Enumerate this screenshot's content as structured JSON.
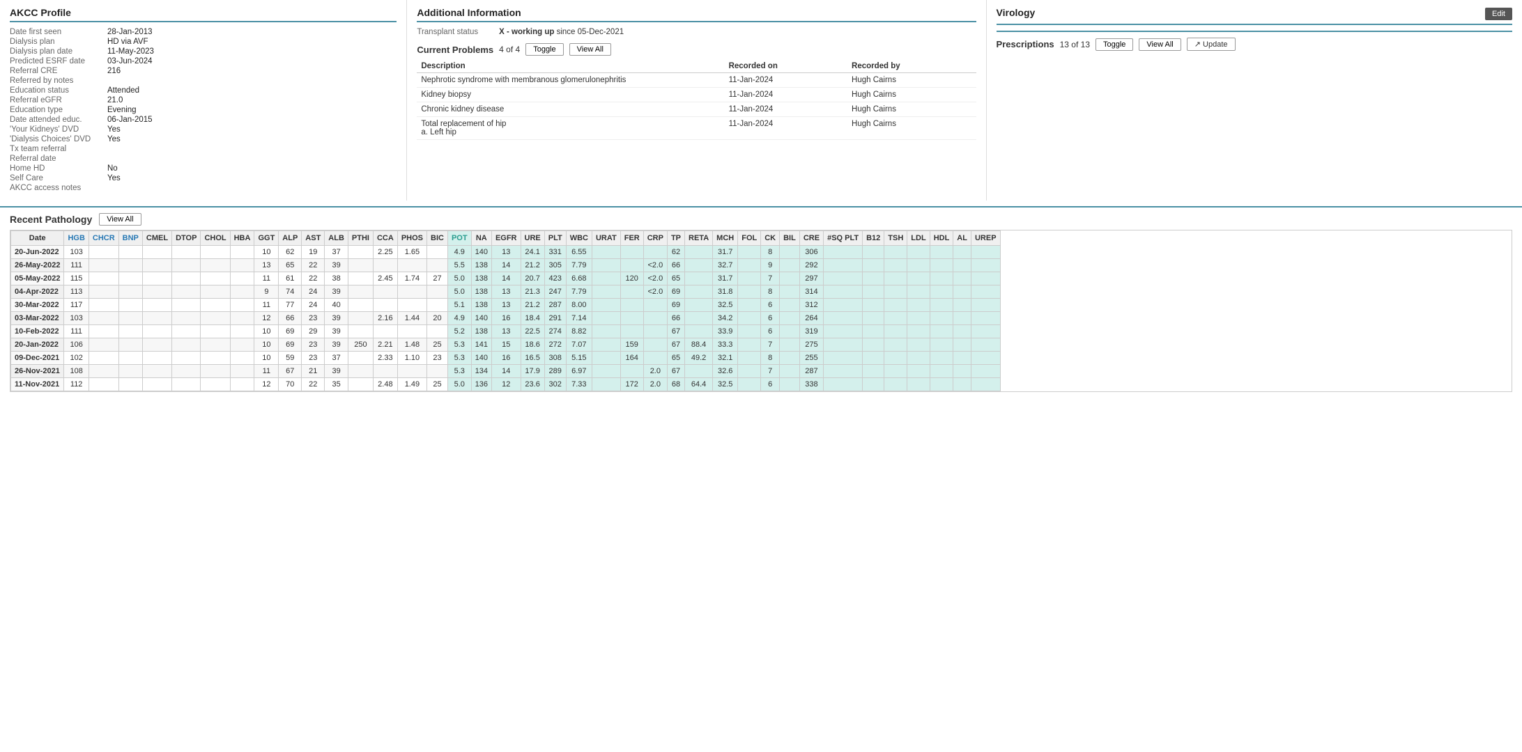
{
  "akcc": {
    "title": "AKCC Profile",
    "fields": [
      {
        "label": "Date first seen",
        "value": "28-Jan-2013"
      },
      {
        "label": "Dialysis plan",
        "value": "HD via AVF"
      },
      {
        "label": "Dialysis plan date",
        "value": "11-May-2023"
      },
      {
        "label": "Predicted ESRF date",
        "value": "03-Jun-2024"
      },
      {
        "label": "Referral CRE",
        "value": "216"
      },
      {
        "label": "Referred by notes",
        "value": ""
      },
      {
        "label": "Education status",
        "value": "Attended"
      },
      {
        "label": "Referral eGFR",
        "value": "21.0"
      },
      {
        "label": "Education type",
        "value": "Evening"
      },
      {
        "label": "Date attended educ.",
        "value": "06-Jan-2015"
      },
      {
        "label": "'Your Kidneys' DVD",
        "value": "Yes"
      },
      {
        "label": "'Dialysis Choices' DVD",
        "value": "Yes"
      },
      {
        "label": "Tx team referral",
        "value": ""
      },
      {
        "label": "Referral date",
        "value": ""
      },
      {
        "label": "Home HD",
        "value": "No"
      },
      {
        "label": "Self Care",
        "value": "Yes"
      },
      {
        "label": "AKCC access notes",
        "value": ""
      }
    ]
  },
  "additional": {
    "title": "Additional Information",
    "transplant_label": "Transplant status",
    "transplant_value": "X - working up since 05-Dec-2021",
    "transplant_bold": "X - working up",
    "transplant_rest": " since 05-Dec-2021",
    "current_problems": {
      "title": "Current Problems",
      "count": "4 of 4",
      "toggle_label": "Toggle",
      "view_all_label": "View All",
      "columns": [
        "Description",
        "Recorded on",
        "Recorded by"
      ],
      "rows": [
        {
          "desc": "Nephrotic syndrome with membranous glomerulonephritis",
          "date": "11-Jan-2024",
          "by": "Hugh Cairns"
        },
        {
          "desc": "Kidney biopsy",
          "date": "11-Jan-2024",
          "by": "Hugh Cairns"
        },
        {
          "desc": "Chronic kidney disease",
          "date": "11-Jan-2024",
          "by": "Hugh Cairns"
        },
        {
          "desc": "Total replacement of hip\na.  Left hip",
          "date": "11-Jan-2024",
          "by": "Hugh Cairns"
        }
      ]
    }
  },
  "virology": {
    "title": "Virology",
    "edit_label": "Edit",
    "prescriptions": {
      "label": "Prescriptions",
      "count": "13 of 13",
      "toggle_label": "Toggle",
      "view_all_label": "View All",
      "update_label": "↗ Update"
    }
  },
  "pathology": {
    "title": "Recent Pathology",
    "view_all_label": "View All",
    "columns": [
      "Date",
      "HGB",
      "CHCR",
      "BNP",
      "CMEL",
      "DTOP",
      "CHOL",
      "HBA",
      "GGT",
      "ALP",
      "AST",
      "ALB",
      "PTHI",
      "CCA",
      "PHOS",
      "BIC",
      "POT",
      "NA",
      "EGFR",
      "URE",
      "PLT",
      "WBC",
      "URAT",
      "FER",
      "CRP",
      "TP",
      "RETA",
      "MCH",
      "FOL",
      "CK",
      "BIL",
      "CRE",
      "#SQ PLT",
      "B12",
      "TSH",
      "LDL",
      "HDL",
      "AL",
      "UREP"
    ],
    "rows": [
      {
        "date": "20-Jun-2022",
        "HGB": "103",
        "CHCR": "",
        "BNP": "",
        "CMEL": "",
        "DTOP": "",
        "CHOL": "",
        "HBA": "",
        "GGT": "10",
        "ALP": "62",
        "AST": "19",
        "ALB": "37",
        "PTHI": "",
        "CCA": "2.25",
        "PHOS": "1.65",
        "BIC": "",
        "POT": "4.9",
        "NA": "140",
        "EGFR": "13",
        "URE": "24.1",
        "PLT": "331",
        "WBC": "6.55",
        "URAT": "",
        "FER": "",
        "CRP": "",
        "TP": "62",
        "RETA": "",
        "MCH": "31.7",
        "FOL": "",
        "CK": "8",
        "BIL": "",
        "CRE": "306",
        "SQ_PLT": "",
        "B12": "",
        "TSH": "",
        "LDL": "",
        "HDL": "",
        "AL": "",
        "UREP": ""
      },
      {
        "date": "26-May-2022",
        "HGB": "111",
        "CHCR": "",
        "BNP": "",
        "CMEL": "",
        "DTOP": "",
        "CHOL": "",
        "HBA": "",
        "GGT": "13",
        "ALP": "65",
        "AST": "22",
        "ALB": "39",
        "PTHI": "",
        "CCA": "",
        "PHOS": "",
        "BIC": "",
        "POT": "5.5",
        "NA": "138",
        "EGFR": "14",
        "URE": "21.2",
        "PLT": "305",
        "WBC": "7.79",
        "URAT": "",
        "FER": "",
        "CRP": "<2.0",
        "TP": "66",
        "RETA": "",
        "MCH": "32.7",
        "FOL": "",
        "CK": "9",
        "BIL": "",
        "CRE": "292",
        "SQ_PLT": "",
        "B12": "",
        "TSH": "",
        "LDL": "",
        "HDL": "",
        "AL": "",
        "UREP": ""
      },
      {
        "date": "05-May-2022",
        "HGB": "115",
        "CHCR": "",
        "BNP": "",
        "CMEL": "",
        "DTOP": "",
        "CHOL": "",
        "HBA": "",
        "GGT": "11",
        "ALP": "61",
        "AST": "22",
        "ALB": "38",
        "PTHI": "",
        "CCA": "2.45",
        "PHOS": "1.74",
        "BIC": "27",
        "POT": "5.0",
        "NA": "138",
        "EGFR": "14",
        "URE": "20.7",
        "PLT": "423",
        "WBC": "6.68",
        "URAT": "",
        "FER": "120",
        "CRP": "<2.0",
        "TP": "65",
        "RETA": "",
        "MCH": "31.7",
        "FOL": "",
        "CK": "7",
        "BIL": "",
        "CRE": "297",
        "SQ_PLT": "",
        "B12": "",
        "TSH": "",
        "LDL": "",
        "HDL": "",
        "AL": "",
        "UREP": ""
      },
      {
        "date": "04-Apr-2022",
        "HGB": "113",
        "CHCR": "",
        "BNP": "",
        "CMEL": "",
        "DTOP": "",
        "CHOL": "",
        "HBA": "",
        "GGT": "9",
        "ALP": "74",
        "AST": "24",
        "ALB": "39",
        "PTHI": "",
        "CCA": "",
        "PHOS": "",
        "BIC": "",
        "POT": "5.0",
        "NA": "138",
        "EGFR": "13",
        "URE": "21.3",
        "PLT": "247",
        "WBC": "7.79",
        "URAT": "",
        "FER": "",
        "CRP": "<2.0",
        "TP": "69",
        "RETA": "",
        "MCH": "31.8",
        "FOL": "",
        "CK": "8",
        "BIL": "",
        "CRE": "314",
        "SQ_PLT": "",
        "B12": "",
        "TSH": "",
        "LDL": "",
        "HDL": "",
        "AL": "",
        "UREP": ""
      },
      {
        "date": "30-Mar-2022",
        "HGB": "117",
        "CHCR": "",
        "BNP": "",
        "CMEL": "",
        "DTOP": "",
        "CHOL": "",
        "HBA": "",
        "GGT": "11",
        "ALP": "77",
        "AST": "24",
        "ALB": "40",
        "PTHI": "",
        "CCA": "",
        "PHOS": "",
        "BIC": "",
        "POT": "5.1",
        "NA": "138",
        "EGFR": "13",
        "URE": "21.2",
        "PLT": "287",
        "WBC": "8.00",
        "URAT": "",
        "FER": "",
        "CRP": "",
        "TP": "69",
        "RETA": "",
        "MCH": "32.5",
        "FOL": "",
        "CK": "6",
        "BIL": "",
        "CRE": "312",
        "SQ_PLT": "",
        "B12": "",
        "TSH": "",
        "LDL": "",
        "HDL": "",
        "AL": "",
        "UREP": ""
      },
      {
        "date": "03-Mar-2022",
        "HGB": "103",
        "CHCR": "",
        "BNP": "",
        "CMEL": "",
        "DTOP": "",
        "CHOL": "",
        "HBA": "",
        "GGT": "12",
        "ALP": "66",
        "AST": "23",
        "ALB": "39",
        "PTHI": "",
        "CCA": "2.16",
        "PHOS": "1.44",
        "BIC": "20",
        "POT": "4.9",
        "NA": "140",
        "EGFR": "16",
        "URE": "18.4",
        "PLT": "291",
        "WBC": "7.14",
        "URAT": "",
        "FER": "",
        "CRP": "",
        "TP": "66",
        "RETA": "",
        "MCH": "34.2",
        "FOL": "",
        "CK": "6",
        "BIL": "",
        "CRE": "264",
        "SQ_PLT": "",
        "B12": "",
        "TSH": "",
        "LDL": "",
        "HDL": "",
        "AL": "",
        "UREP": ""
      },
      {
        "date": "10-Feb-2022",
        "HGB": "111",
        "CHCR": "",
        "BNP": "",
        "CMEL": "",
        "DTOP": "",
        "CHOL": "",
        "HBA": "",
        "GGT": "10",
        "ALP": "69",
        "AST": "29",
        "ALB": "39",
        "PTHI": "",
        "CCA": "",
        "PHOS": "",
        "BIC": "",
        "POT": "5.2",
        "NA": "138",
        "EGFR": "13",
        "URE": "22.5",
        "PLT": "274",
        "WBC": "8.82",
        "URAT": "",
        "FER": "",
        "CRP": "",
        "TP": "67",
        "RETA": "",
        "MCH": "33.9",
        "FOL": "",
        "CK": "6",
        "BIL": "",
        "CRE": "319",
        "SQ_PLT": "",
        "B12": "",
        "TSH": "",
        "LDL": "",
        "HDL": "",
        "AL": "",
        "UREP": ""
      },
      {
        "date": "20-Jan-2022",
        "HGB": "106",
        "CHCR": "",
        "BNP": "",
        "CMEL": "",
        "DTOP": "",
        "CHOL": "",
        "HBA": "",
        "GGT": "10",
        "ALP": "69",
        "AST": "23",
        "ALB": "39",
        "PTHI": "250",
        "CCA": "2.21",
        "PHOS": "1.48",
        "BIC": "25",
        "POT": "5.3",
        "NA": "141",
        "EGFR": "15",
        "URE": "18.6",
        "PLT": "272",
        "WBC": "7.07",
        "URAT": "",
        "FER": "159",
        "CRP": "",
        "TP": "67",
        "RETA": "88.4",
        "MCH": "33.3",
        "FOL": "",
        "CK": "7",
        "BIL": "",
        "CRE": "275",
        "SQ_PLT": "",
        "B12": "",
        "TSH": "",
        "LDL": "",
        "HDL": "",
        "AL": "",
        "UREP": ""
      },
      {
        "date": "09-Dec-2021",
        "HGB": "102",
        "CHCR": "",
        "BNP": "",
        "CMEL": "",
        "DTOP": "",
        "CHOL": "",
        "HBA": "",
        "GGT": "10",
        "ALP": "59",
        "AST": "23",
        "ALB": "37",
        "PTHI": "",
        "CCA": "2.33",
        "PHOS": "1.10",
        "BIC": "23",
        "POT": "5.3",
        "NA": "140",
        "EGFR": "16",
        "URE": "16.5",
        "PLT": "308",
        "WBC": "5.15",
        "URAT": "",
        "FER": "164",
        "CRP": "",
        "TP": "65",
        "RETA": "49.2",
        "MCH": "32.1",
        "FOL": "",
        "CK": "8",
        "BIL": "",
        "CRE": "255",
        "SQ_PLT": "",
        "B12": "",
        "TSH": "",
        "LDL": "",
        "HDL": "",
        "AL": "",
        "UREP": ""
      },
      {
        "date": "26-Nov-2021",
        "HGB": "108",
        "CHCR": "",
        "BNP": "",
        "CMEL": "",
        "DTOP": "",
        "CHOL": "",
        "HBA": "",
        "GGT": "11",
        "ALP": "67",
        "AST": "21",
        "ALB": "39",
        "PTHI": "",
        "CCA": "",
        "PHOS": "",
        "BIC": "",
        "POT": "5.3",
        "NA": "134",
        "EGFR": "14",
        "URE": "17.9",
        "PLT": "289",
        "WBC": "6.97",
        "URAT": "",
        "FER": "",
        "CRP": "2.0",
        "TP": "67",
        "RETA": "",
        "MCH": "32.6",
        "FOL": "",
        "CK": "7",
        "BIL": "",
        "CRE": "287",
        "SQ_PLT": "",
        "B12": "",
        "TSH": "",
        "LDL": "",
        "HDL": "",
        "AL": "",
        "UREP": ""
      },
      {
        "date": "11-Nov-2021",
        "HGB": "112",
        "CHCR": "",
        "BNP": "",
        "CMEL": "",
        "DTOP": "",
        "CHOL": "",
        "HBA": "",
        "GGT": "12",
        "ALP": "70",
        "AST": "22",
        "ALB": "35",
        "PTHI": "",
        "CCA": "2.48",
        "PHOS": "1.49",
        "BIC": "25",
        "POT": "5.0",
        "NA": "136",
        "EGFR": "12",
        "URE": "23.6",
        "PLT": "302",
        "WBC": "7.33",
        "URAT": "",
        "FER": "172",
        "CRP": "2.0",
        "TP": "68",
        "RETA": "64.4",
        "MCH": "32.5",
        "FOL": "",
        "CK": "6",
        "BIL": "",
        "CRE": "338",
        "SQ_PLT": "",
        "B12": "",
        "TSH": "",
        "LDL": "",
        "HDL": "",
        "AL": "",
        "UREP": ""
      }
    ]
  }
}
